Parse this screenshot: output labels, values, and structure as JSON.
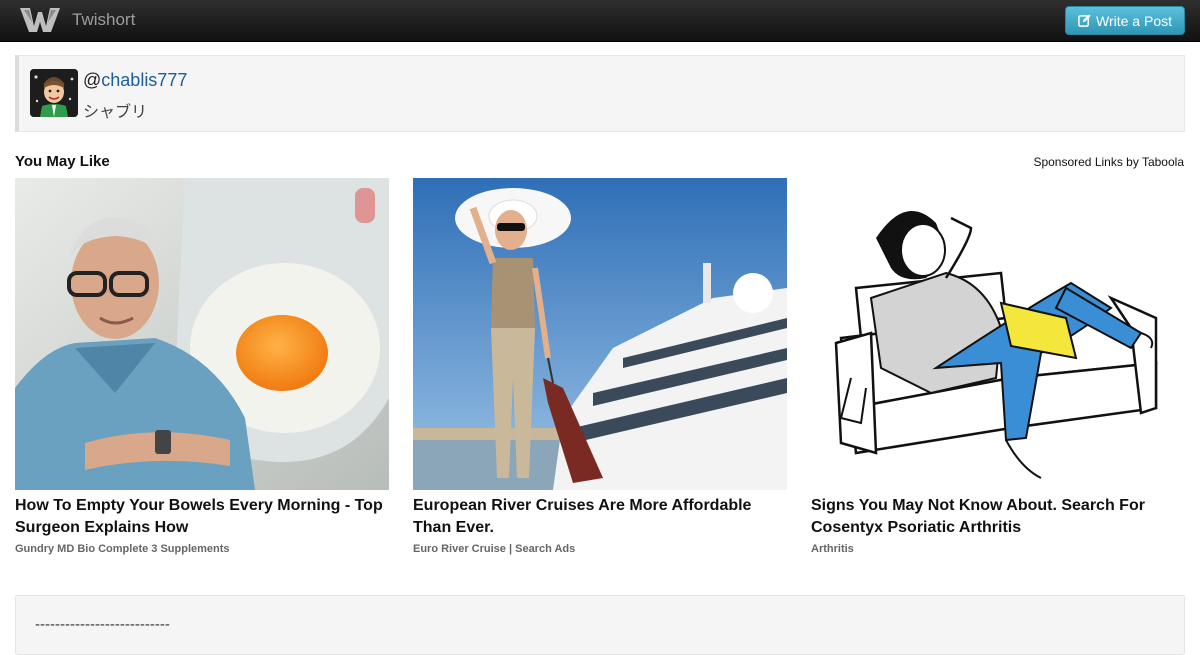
{
  "app": {
    "brand_name": "Twishort",
    "logo_icon": "twishort-logo-icon"
  },
  "nav": {
    "write_button_label": "Write a Post",
    "write_button_icon": "edit-icon"
  },
  "profile": {
    "handle_prefix": "@",
    "handle": "chablis777",
    "display_name": "シャブリ",
    "avatar_icon": "avatar"
  },
  "recommendations": {
    "heading": "You May Like",
    "sponsored_label": "Sponsored Links by Taboola",
    "items": [
      {
        "title": "How To Empty Your Bowels Every Morning - Top Surgeon Explains How",
        "source": "Gundry MD Bio Complete 3 Supplements"
      },
      {
        "title": "European River Cruises Are More Affordable Than Ever.",
        "source": "Euro River Cruise | Search Ads"
      },
      {
        "title": "Signs You May Not Know About. Search For Cosentyx Psoriatic Arthritis",
        "source": "Arthritis"
      }
    ]
  },
  "post": {
    "text": "---------------------------"
  },
  "colors": {
    "navbar": "#1b1b1b",
    "button": "#49afcd",
    "link": "#1a5ea0",
    "well": "#f5f5f5"
  }
}
